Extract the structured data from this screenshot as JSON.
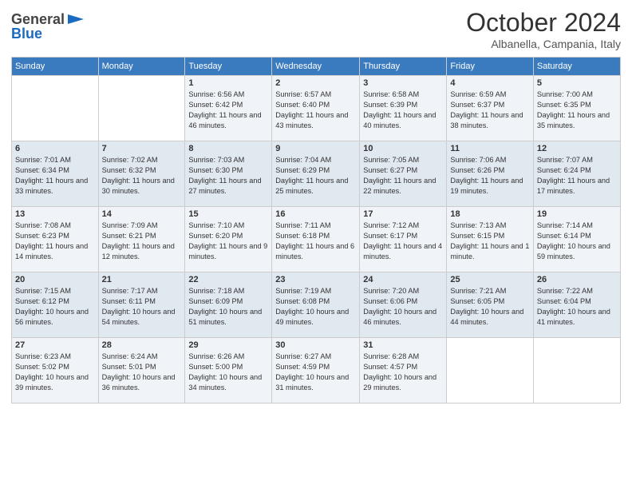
{
  "header": {
    "logo_line1": "General",
    "logo_line2": "Blue",
    "month": "October 2024",
    "location": "Albanella, Campania, Italy"
  },
  "days_of_week": [
    "Sunday",
    "Monday",
    "Tuesday",
    "Wednesday",
    "Thursday",
    "Friday",
    "Saturday"
  ],
  "weeks": [
    [
      {
        "day": "",
        "sunrise": "",
        "sunset": "",
        "daylight": ""
      },
      {
        "day": "",
        "sunrise": "",
        "sunset": "",
        "daylight": ""
      },
      {
        "day": "1",
        "sunrise": "Sunrise: 6:56 AM",
        "sunset": "Sunset: 6:42 PM",
        "daylight": "Daylight: 11 hours and 46 minutes."
      },
      {
        "day": "2",
        "sunrise": "Sunrise: 6:57 AM",
        "sunset": "Sunset: 6:40 PM",
        "daylight": "Daylight: 11 hours and 43 minutes."
      },
      {
        "day": "3",
        "sunrise": "Sunrise: 6:58 AM",
        "sunset": "Sunset: 6:39 PM",
        "daylight": "Daylight: 11 hours and 40 minutes."
      },
      {
        "day": "4",
        "sunrise": "Sunrise: 6:59 AM",
        "sunset": "Sunset: 6:37 PM",
        "daylight": "Daylight: 11 hours and 38 minutes."
      },
      {
        "day": "5",
        "sunrise": "Sunrise: 7:00 AM",
        "sunset": "Sunset: 6:35 PM",
        "daylight": "Daylight: 11 hours and 35 minutes."
      }
    ],
    [
      {
        "day": "6",
        "sunrise": "Sunrise: 7:01 AM",
        "sunset": "Sunset: 6:34 PM",
        "daylight": "Daylight: 11 hours and 33 minutes."
      },
      {
        "day": "7",
        "sunrise": "Sunrise: 7:02 AM",
        "sunset": "Sunset: 6:32 PM",
        "daylight": "Daylight: 11 hours and 30 minutes."
      },
      {
        "day": "8",
        "sunrise": "Sunrise: 7:03 AM",
        "sunset": "Sunset: 6:30 PM",
        "daylight": "Daylight: 11 hours and 27 minutes."
      },
      {
        "day": "9",
        "sunrise": "Sunrise: 7:04 AM",
        "sunset": "Sunset: 6:29 PM",
        "daylight": "Daylight: 11 hours and 25 minutes."
      },
      {
        "day": "10",
        "sunrise": "Sunrise: 7:05 AM",
        "sunset": "Sunset: 6:27 PM",
        "daylight": "Daylight: 11 hours and 22 minutes."
      },
      {
        "day": "11",
        "sunrise": "Sunrise: 7:06 AM",
        "sunset": "Sunset: 6:26 PM",
        "daylight": "Daylight: 11 hours and 19 minutes."
      },
      {
        "day": "12",
        "sunrise": "Sunrise: 7:07 AM",
        "sunset": "Sunset: 6:24 PM",
        "daylight": "Daylight: 11 hours and 17 minutes."
      }
    ],
    [
      {
        "day": "13",
        "sunrise": "Sunrise: 7:08 AM",
        "sunset": "Sunset: 6:23 PM",
        "daylight": "Daylight: 11 hours and 14 minutes."
      },
      {
        "day": "14",
        "sunrise": "Sunrise: 7:09 AM",
        "sunset": "Sunset: 6:21 PM",
        "daylight": "Daylight: 11 hours and 12 minutes."
      },
      {
        "day": "15",
        "sunrise": "Sunrise: 7:10 AM",
        "sunset": "Sunset: 6:20 PM",
        "daylight": "Daylight: 11 hours and 9 minutes."
      },
      {
        "day": "16",
        "sunrise": "Sunrise: 7:11 AM",
        "sunset": "Sunset: 6:18 PM",
        "daylight": "Daylight: 11 hours and 6 minutes."
      },
      {
        "day": "17",
        "sunrise": "Sunrise: 7:12 AM",
        "sunset": "Sunset: 6:17 PM",
        "daylight": "Daylight: 11 hours and 4 minutes."
      },
      {
        "day": "18",
        "sunrise": "Sunrise: 7:13 AM",
        "sunset": "Sunset: 6:15 PM",
        "daylight": "Daylight: 11 hours and 1 minute."
      },
      {
        "day": "19",
        "sunrise": "Sunrise: 7:14 AM",
        "sunset": "Sunset: 6:14 PM",
        "daylight": "Daylight: 10 hours and 59 minutes."
      }
    ],
    [
      {
        "day": "20",
        "sunrise": "Sunrise: 7:15 AM",
        "sunset": "Sunset: 6:12 PM",
        "daylight": "Daylight: 10 hours and 56 minutes."
      },
      {
        "day": "21",
        "sunrise": "Sunrise: 7:17 AM",
        "sunset": "Sunset: 6:11 PM",
        "daylight": "Daylight: 10 hours and 54 minutes."
      },
      {
        "day": "22",
        "sunrise": "Sunrise: 7:18 AM",
        "sunset": "Sunset: 6:09 PM",
        "daylight": "Daylight: 10 hours and 51 minutes."
      },
      {
        "day": "23",
        "sunrise": "Sunrise: 7:19 AM",
        "sunset": "Sunset: 6:08 PM",
        "daylight": "Daylight: 10 hours and 49 minutes."
      },
      {
        "day": "24",
        "sunrise": "Sunrise: 7:20 AM",
        "sunset": "Sunset: 6:06 PM",
        "daylight": "Daylight: 10 hours and 46 minutes."
      },
      {
        "day": "25",
        "sunrise": "Sunrise: 7:21 AM",
        "sunset": "Sunset: 6:05 PM",
        "daylight": "Daylight: 10 hours and 44 minutes."
      },
      {
        "day": "26",
        "sunrise": "Sunrise: 7:22 AM",
        "sunset": "Sunset: 6:04 PM",
        "daylight": "Daylight: 10 hours and 41 minutes."
      }
    ],
    [
      {
        "day": "27",
        "sunrise": "Sunrise: 6:23 AM",
        "sunset": "Sunset: 5:02 PM",
        "daylight": "Daylight: 10 hours and 39 minutes."
      },
      {
        "day": "28",
        "sunrise": "Sunrise: 6:24 AM",
        "sunset": "Sunset: 5:01 PM",
        "daylight": "Daylight: 10 hours and 36 minutes."
      },
      {
        "day": "29",
        "sunrise": "Sunrise: 6:26 AM",
        "sunset": "Sunset: 5:00 PM",
        "daylight": "Daylight: 10 hours and 34 minutes."
      },
      {
        "day": "30",
        "sunrise": "Sunrise: 6:27 AM",
        "sunset": "Sunset: 4:59 PM",
        "daylight": "Daylight: 10 hours and 31 minutes."
      },
      {
        "day": "31",
        "sunrise": "Sunrise: 6:28 AM",
        "sunset": "Sunset: 4:57 PM",
        "daylight": "Daylight: 10 hours and 29 minutes."
      },
      {
        "day": "",
        "sunrise": "",
        "sunset": "",
        "daylight": ""
      },
      {
        "day": "",
        "sunrise": "",
        "sunset": "",
        "daylight": ""
      }
    ]
  ]
}
